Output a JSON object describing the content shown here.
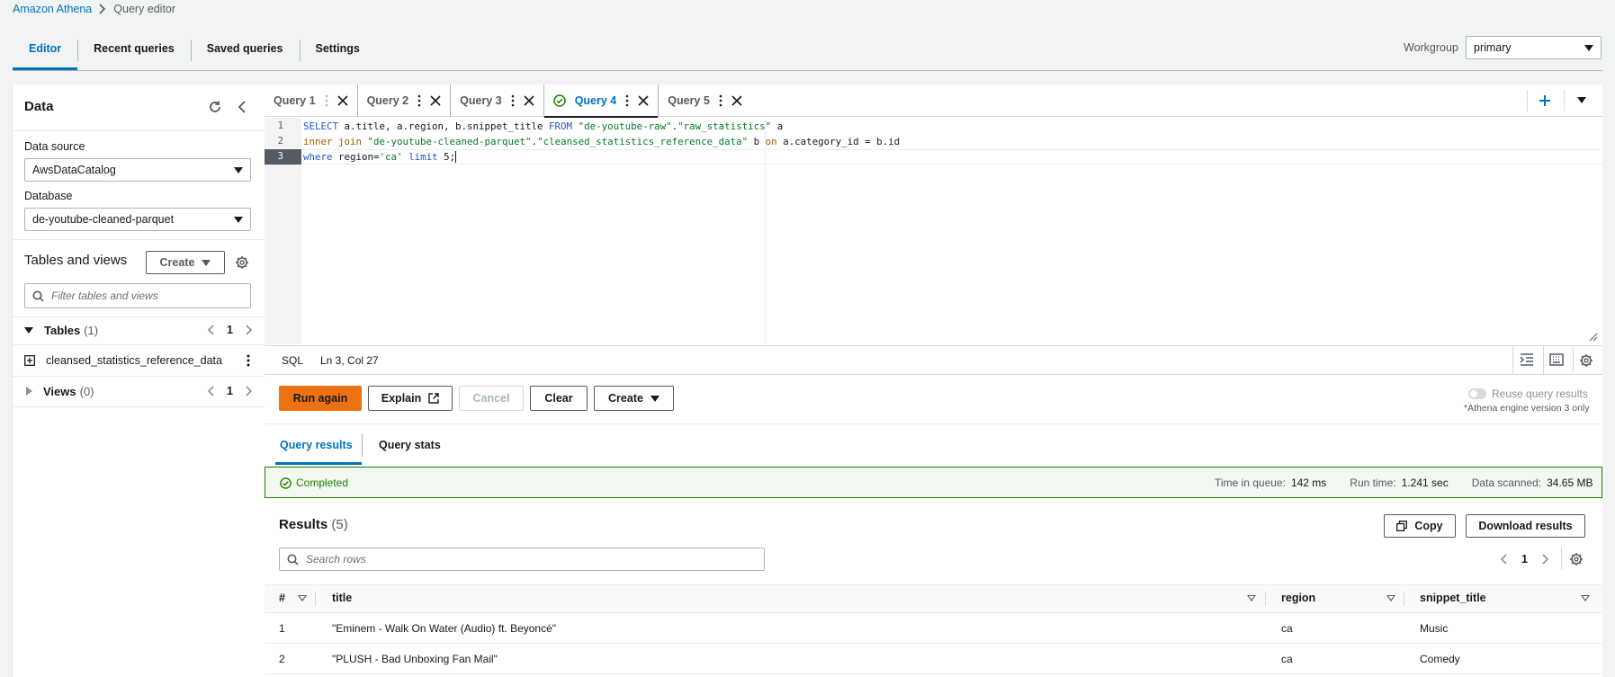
{
  "breadcrumb": {
    "root": "Amazon Athena",
    "current": "Query editor"
  },
  "top_tabs": [
    "Editor",
    "Recent queries",
    "Saved queries",
    "Settings"
  ],
  "workgroup": {
    "label": "Workgroup",
    "value": "primary"
  },
  "data_panel": {
    "title": "Data",
    "data_source_label": "Data source",
    "data_source_value": "AwsDataCatalog",
    "database_label": "Database",
    "database_value": "de-youtube-cleaned-parquet",
    "tables_and_views_title": "Tables and views",
    "create_label": "Create",
    "filter_placeholder": "Filter tables and views",
    "tables_label": "Tables",
    "tables_count": "(1)",
    "tables_page": "1",
    "table_items": [
      "cleansed_statistics_reference_data"
    ],
    "views_label": "Views",
    "views_count": "(0)",
    "views_page": "1"
  },
  "query_tabs": [
    {
      "label": "Query 1"
    },
    {
      "label": "Query 2"
    },
    {
      "label": "Query 3"
    },
    {
      "label": "Query 4"
    },
    {
      "label": "Query 5"
    }
  ],
  "editor": {
    "line_numbers": [
      "1",
      "2",
      "3"
    ],
    "line1": {
      "kw1": "SELECT",
      "t1": " a.title, a.region, b.snippet_title ",
      "kw2": "FROM",
      "t2": " ",
      "s1": "\"de-youtube-raw\"",
      "t3": ".",
      "s2": "\"raw_statistics\"",
      "t4": " a"
    },
    "line2": {
      "kw1": "inner join",
      "t1": " ",
      "s1": "\"de-youtube-cleaned-parquet\"",
      "t2": ".",
      "s2": "\"cleansed_statistics_reference_data\"",
      "t3": " b ",
      "kw2": "on",
      "t4": " a.category_id = b.id"
    },
    "line3": {
      "kw1": "where",
      "t1": " region=",
      "s1": "'ca'",
      "t2": " ",
      "kw2": "limit",
      "t3": " 5;"
    }
  },
  "status_bar": {
    "language": "SQL",
    "cursor": "Ln 3, Col 27"
  },
  "actions": {
    "run_again": "Run again",
    "explain": "Explain",
    "cancel": "Cancel",
    "clear": "Clear",
    "create": "Create",
    "reuse_label": "Reuse query results",
    "engine_note": "*Athena engine version 3 only"
  },
  "results_tabs": [
    "Query results",
    "Query stats"
  ],
  "completion": {
    "status": "Completed",
    "time_in_queue_label": "Time in queue:",
    "time_in_queue": "142 ms",
    "run_time_label": "Run time:",
    "run_time": "1.241 sec",
    "data_scanned_label": "Data scanned:",
    "data_scanned": "34.65 MB"
  },
  "results": {
    "title": "Results",
    "count": "(5)",
    "copy_label": "Copy",
    "download_label": "Download results",
    "search_placeholder": "Search rows",
    "page": "1",
    "columns": [
      "#",
      "title",
      "region",
      "snippet_title"
    ],
    "rows": [
      {
        "n": "1",
        "title": "\"Eminem - Walk On Water (Audio) ft. Beyoncé\"",
        "region": "ca",
        "snippet": "Music"
      },
      {
        "n": "2",
        "title": "\"PLUSH - Bad Unboxing Fan Mail\"",
        "region": "ca",
        "snippet": "Comedy"
      }
    ]
  },
  "colors": {
    "accent": "#0073bb",
    "run_button": "#ec7211",
    "success": "#1d8102"
  }
}
